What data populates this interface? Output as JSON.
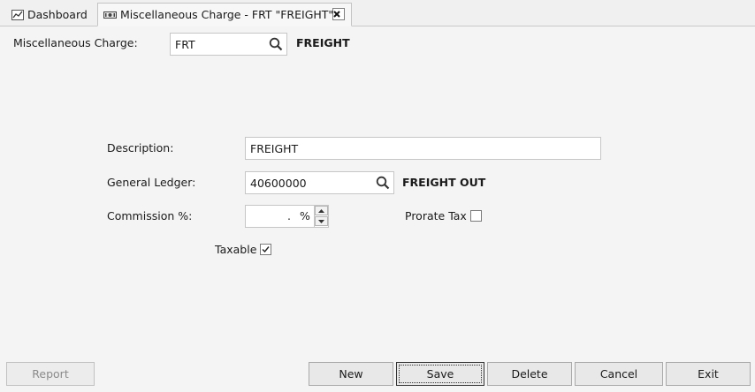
{
  "tabs": {
    "dashboard_label": "Dashboard",
    "misc_label": "Miscellaneous Charge - FRT \"FREIGHT\""
  },
  "header": {
    "label": "Miscellaneous Charge:",
    "code_value": "FRT",
    "code_description": "FREIGHT"
  },
  "form": {
    "description_label": "Description:",
    "description_value": "FREIGHT",
    "gl_label": "General Ledger:",
    "gl_value": "40600000",
    "gl_description": "FREIGHT OUT",
    "commission_label": "Commission %:",
    "commission_value": ".",
    "commission_unit": "%",
    "prorate_label": "Prorate Tax",
    "prorate_checked": false,
    "taxable_label": "Taxable",
    "taxable_checked": true
  },
  "buttons": {
    "report": "Report",
    "new": "New",
    "save": "Save",
    "delete": "Delete",
    "cancel": "Cancel",
    "exit": "Exit"
  },
  "icons": {
    "dashboard_tab": "chart-icon",
    "misc_tab": "money-icon",
    "close": "close-icon",
    "search": "search-icon",
    "check": "checkmark-icon"
  }
}
